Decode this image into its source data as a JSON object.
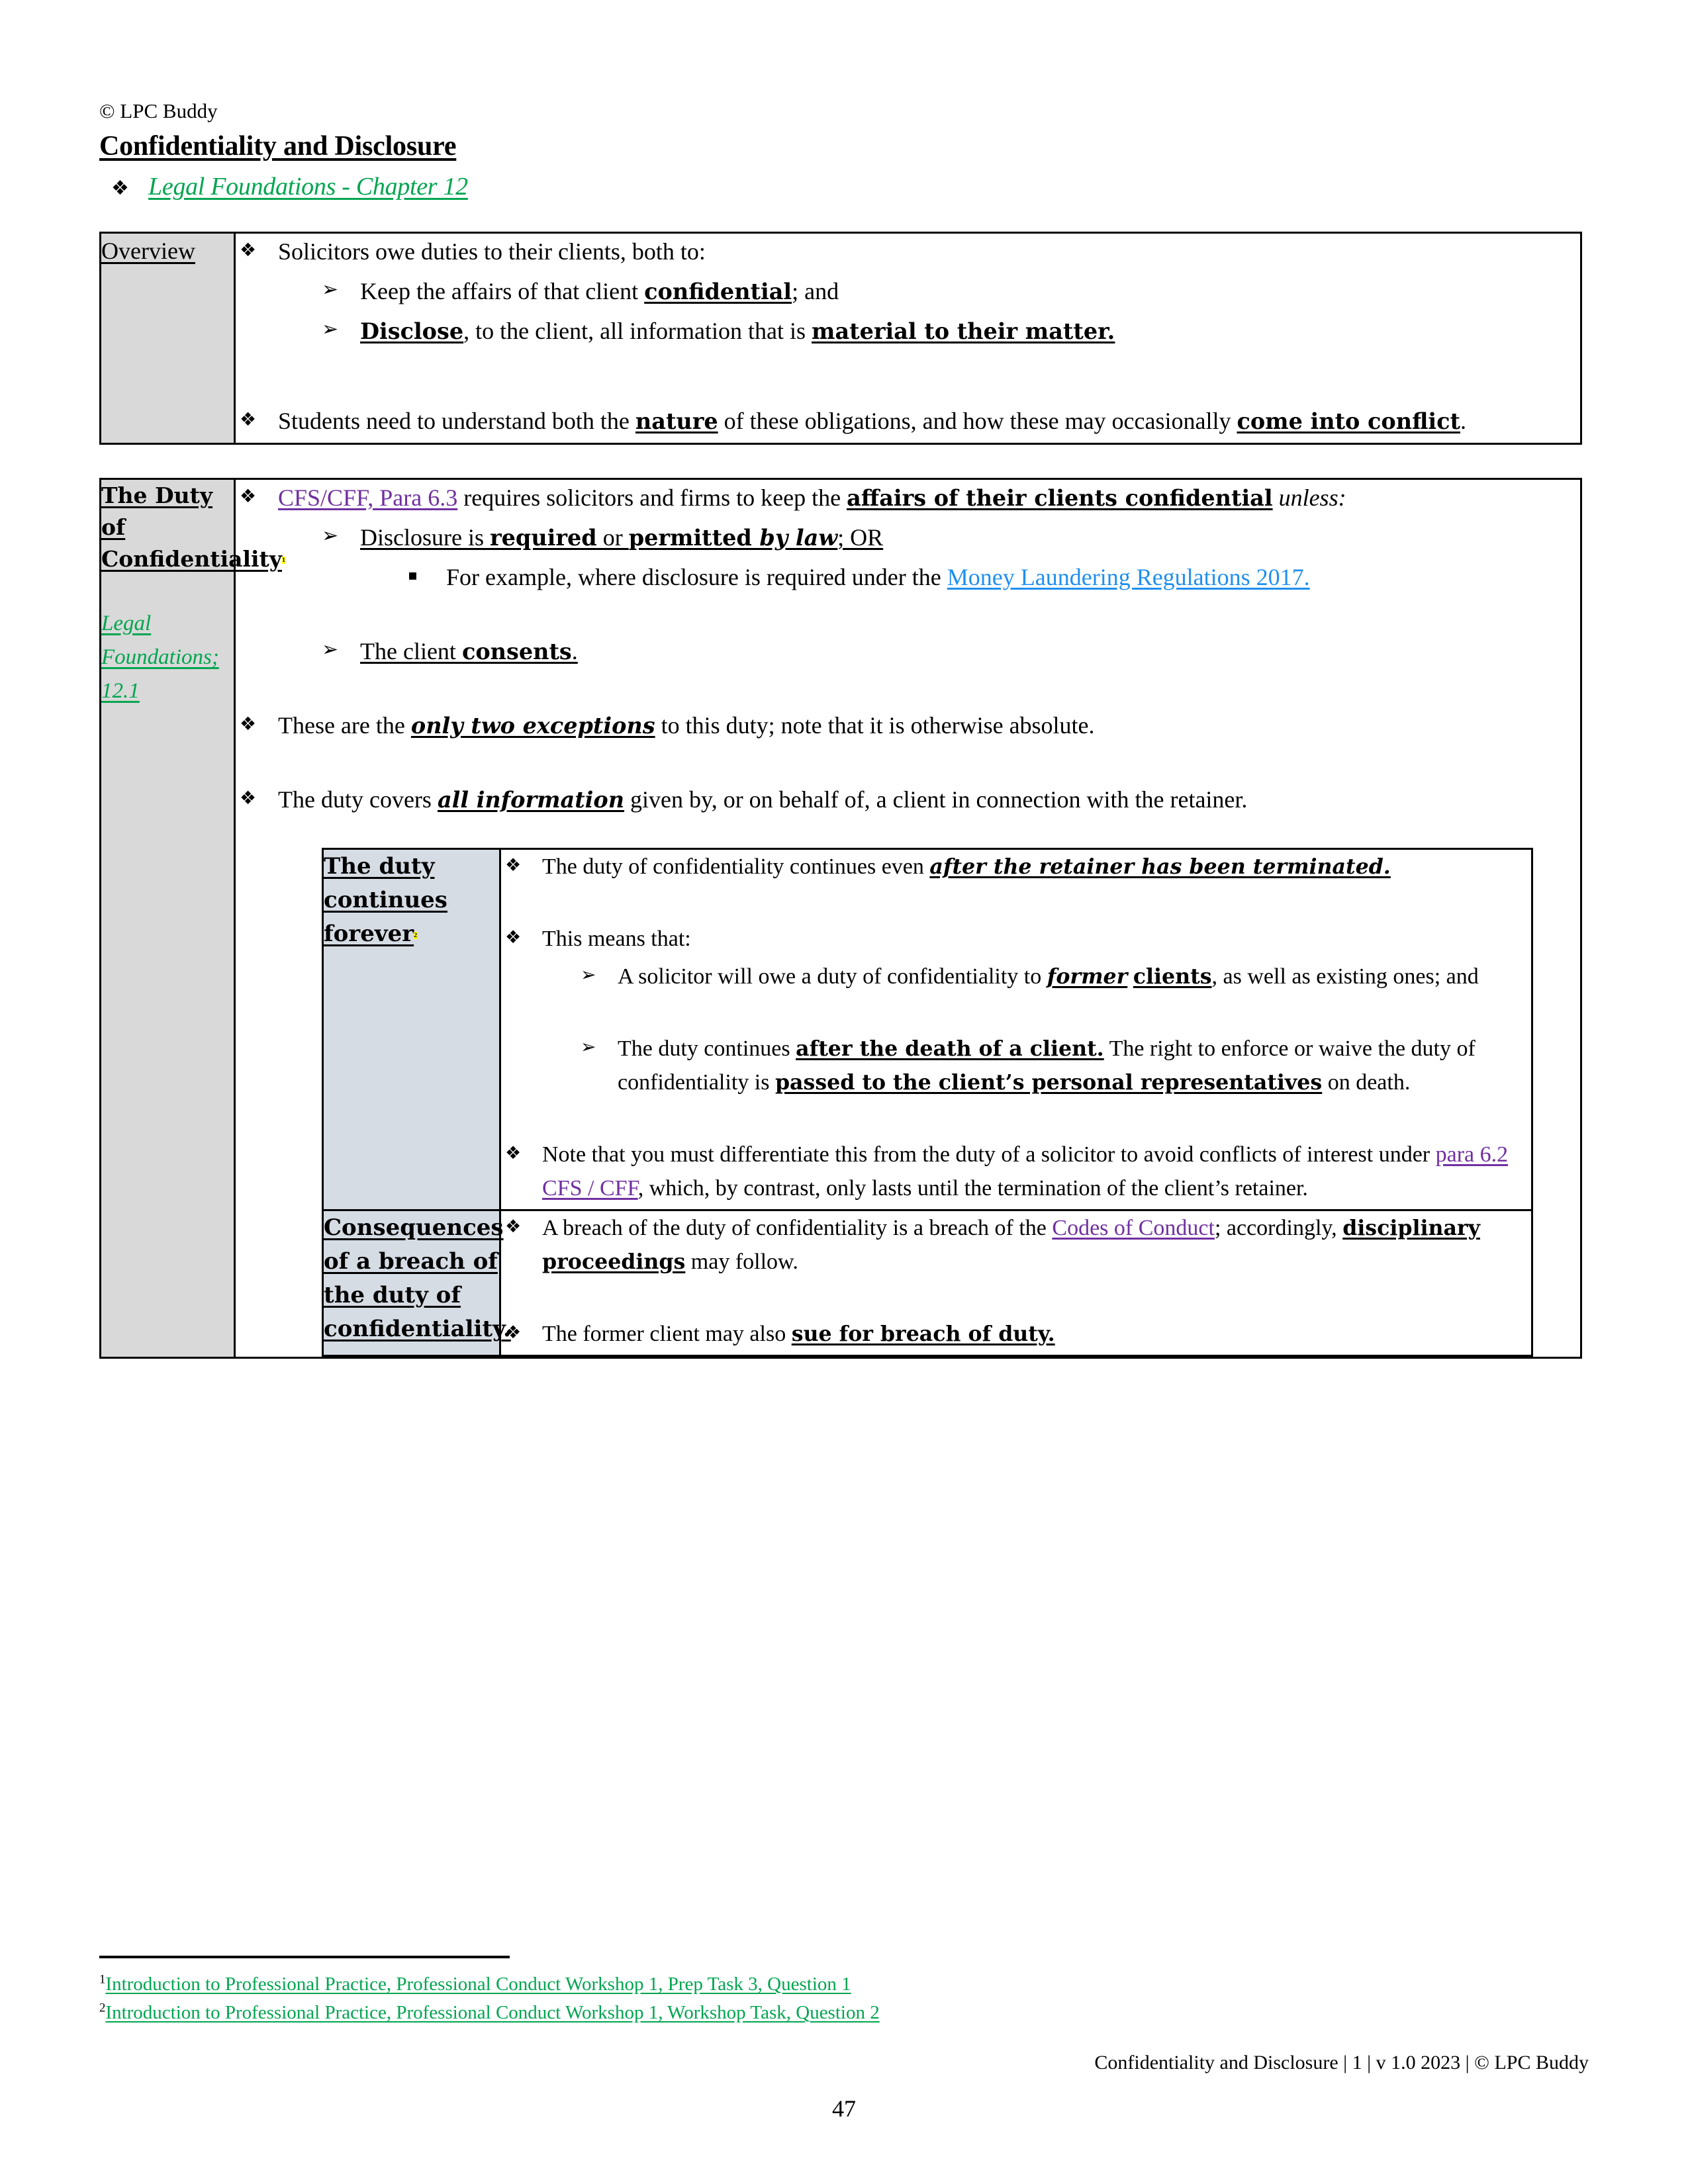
{
  "header": {
    "copyright": "© LPC Buddy",
    "title": "Confidentiality and Disclosure",
    "chapter_link": "Legal Foundations - Chapter 12",
    "bullet_glyph": "❖"
  },
  "colors": {
    "green_link": "#00A550",
    "purple_link": "#7030A0",
    "blue_link": "#1F8FEF",
    "highlight": "#FFFF00",
    "label_cell_bg": "#D9D9D9",
    "nested_label_bg": "#D6DCE4"
  },
  "watermark": {
    "text": "LPC BUDDY"
  },
  "glyphs": {
    "diamond": "❖",
    "arrow": "➢",
    "square": "▪"
  },
  "overview": {
    "label": "Overview",
    "b1": {
      "pre": "Solicitors owe duties to their clients, both to:"
    },
    "b1s1": {
      "pre": "Keep the affairs of that client ",
      "bold": "confidential",
      "post": "; and"
    },
    "b1s2": {
      "bold_lead": "Disclose",
      "mid": ", to the client, all information that is ",
      "bold_tail": "material to their matter."
    },
    "b2": {
      "pre": "Students need to understand both the ",
      "bold1": "nature",
      "mid": " of these obligations, and how these may occasionally ",
      "bold2": "come into conflict",
      "post": "."
    }
  },
  "duty": {
    "label_line1": "The Duty of",
    "label_line2": "Confidentiality",
    "label_footnote": "1",
    "sub_ref_line1": "Legal",
    "sub_ref_line2": "Foundations;",
    "sub_ref_line3": "12.1",
    "b1": {
      "link": "CFS/CFF, Para 6.3",
      "mid": " requires solicitors and firms to keep the ",
      "bold": "affairs of their clients confidential",
      "italic": " unless:"
    },
    "b1s1": {
      "pre": "Disclosure is ",
      "bold1": "required",
      "mid": " or ",
      "bold2": "permitted",
      "bolditalic": " by law",
      "post": "; OR"
    },
    "b1s1s1": {
      "pre": "For example, where disclosure is required under the ",
      "link": "Money Laundering Regulations 2017."
    },
    "b1s2": {
      "pre": "The client ",
      "bold": "consents",
      "post": "."
    },
    "b2": {
      "pre": "These are the ",
      "bolditalic": "only two exceptions",
      "post": " to this duty; note that it is otherwise absolute."
    },
    "b3": {
      "pre": "The duty covers ",
      "bolditalic": "all information",
      "post": " given by, or on behalf of, a client in connection with the retainer."
    }
  },
  "nested": {
    "row1": {
      "label_line1": "The duty",
      "label_line2": "continues",
      "label_line3": "forever",
      "label_footnote": "2",
      "b1": {
        "pre": "The duty of confidentiality continues even ",
        "bolditalic": "after the retainer has been terminated."
      },
      "b2": {
        "text": "This means that:"
      },
      "b2s1": {
        "pre": "A solicitor will owe a duty of confidentiality to ",
        "bolditalic": "former",
        "bold2": "clients",
        "post": ", as well as existing ones; and"
      },
      "b2s2": {
        "pre": "The duty continues ",
        "bold1": "after the death of a client.",
        "mid": " The right to enforce or waive the duty of confidentiality is ",
        "bold2": "passed to the client’s personal representatives",
        "post": " on death."
      },
      "b3": {
        "pre": "Note that you must differentiate this from the duty of a solicitor to avoid conflicts of interest under ",
        "link": "para 6.2 CFS / CFF",
        "post": ", which, by contrast, only lasts until the termination of the client’s retainer."
      }
    },
    "row2": {
      "label_line1": "Consequences",
      "label_line2": "of a breach of",
      "label_line3": "the duty of",
      "label_line4": "confidentiality.",
      "b1": {
        "pre": "A breach of the duty of confidentiality is a breach of the ",
        "link": "Codes of Conduct",
        "mid": "; accordingly, ",
        "bold": "disciplinary proceedings",
        "post": " may follow."
      },
      "b2": {
        "pre": "The former client may also ",
        "bold": "sue for breach of duty."
      }
    }
  },
  "footnotes": [
    {
      "num": "1",
      "text": "Introduction to Professional Practice, Professional Conduct Workshop 1, Prep Task 3, Question 1"
    },
    {
      "num": "2",
      "text": "Introduction to Professional Practice, Professional Conduct Workshop 1, Workshop Task, Question 2"
    }
  ],
  "footer": {
    "text": "Confidentiality and Disclosure | 1 | v 1.0 2023 | © LPC Buddy",
    "page_number": "47"
  }
}
